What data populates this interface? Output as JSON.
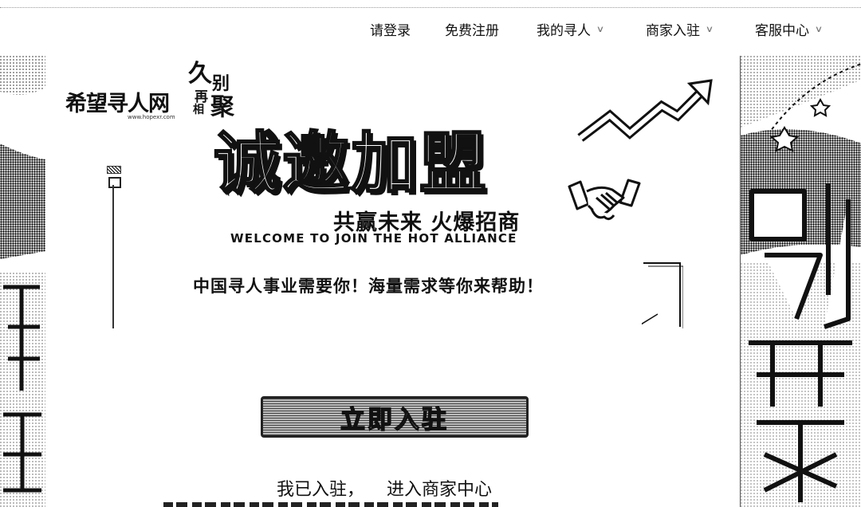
{
  "nav": {
    "login": "请登录",
    "register": "免费注册",
    "my_search": "我的寻人",
    "merchant": "商家入驻",
    "service": "客服中心"
  },
  "logo": {
    "name": "希望寻人网",
    "url": "www.hopexr.com",
    "slogan_chars": [
      "久",
      "别",
      "再",
      "相",
      "聚"
    ]
  },
  "hero": {
    "title": "诚邀加盟",
    "subtitle": "共赢未来 火爆招商",
    "subtitle_en": "WELCOME TO JOIN THE HOT ALLIANCE",
    "tagline": "中国寻人事业需要你！海量需求等你来帮助！",
    "cta_label": "立即入驻",
    "already_part1": "我已入驻，",
    "already_part2": "进入商家中心"
  },
  "side_right": {
    "chars": [
      "别",
      "聚"
    ]
  },
  "side_left": {
    "chars": [
      "寻"
    ]
  },
  "colors": {
    "ink": "#111111",
    "background": "#ffffff"
  }
}
